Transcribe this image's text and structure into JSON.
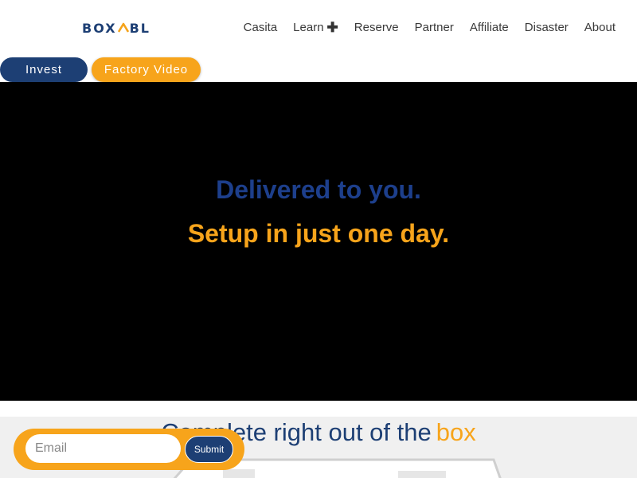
{
  "header": {
    "logo_text_left": "BOX",
    "logo_text_right": "BL",
    "nav": [
      {
        "label": "Casita"
      },
      {
        "label": "Learn"
      },
      {
        "label": "Reserve"
      },
      {
        "label": "Partner"
      },
      {
        "label": "Affiliate"
      },
      {
        "label": "Disaster"
      },
      {
        "label": "About"
      }
    ],
    "learn_icon": "plus-icon"
  },
  "buttons": {
    "invest_label": "Invest",
    "factory_video_label": "Factory Video"
  },
  "hero": {
    "line1": "Delivered to you.",
    "line2": "Setup in just one day."
  },
  "section": {
    "heading_main": "Complete right out of the",
    "heading_accent": "box"
  },
  "signup": {
    "email_placeholder": "Email",
    "submit_label": "Submit"
  },
  "colors": {
    "brand_blue": "#1d3f74",
    "brand_orange": "#f7a41b",
    "hero_background": "#000000"
  }
}
